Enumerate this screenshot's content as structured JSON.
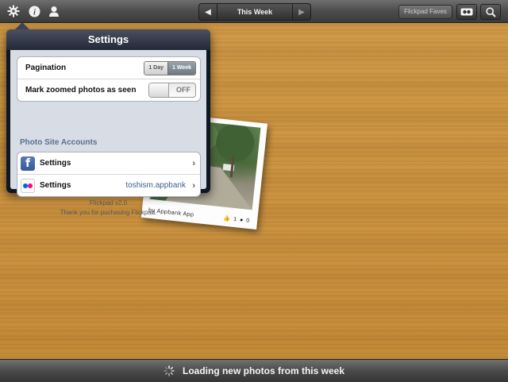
{
  "topbar": {
    "left_icons": [
      "gear-icon",
      "info-icon",
      "person-icon"
    ],
    "week_label": "This Week",
    "prev_icon": "triangle-left-icon",
    "next_icon": "triangle-right-icon",
    "faves_label": "Flickpad Faves",
    "right_icons": [
      "flickr-dots-icon",
      "search-icon"
    ]
  },
  "settings": {
    "title": "Settings",
    "pagination": {
      "label": "Pagination",
      "options": [
        "1 Day",
        "1 Week"
      ],
      "selected": "1 Week"
    },
    "mark_zoomed": {
      "label": "Mark zoomed photos as seen",
      "state": "OFF"
    },
    "accounts_title": "Photo Site Accounts",
    "accounts": [
      {
        "service_icon": "facebook-icon",
        "label": "Settings",
        "value": ""
      },
      {
        "service_icon": "flickr-icon",
        "label": "Settings",
        "value": "toshism.appbank"
      }
    ],
    "version": "Flickpad v2.0",
    "thanks": "Thank you for puchasing Flickpad."
  },
  "photo": {
    "caption": "by Appbank App",
    "likes": "1",
    "comments": "0"
  },
  "status": {
    "icon": "spinner-icon",
    "text": "Loading new photos from this week"
  },
  "colors": {
    "wood": "#cf9540",
    "bar": "#4a4a4a",
    "accent_link": "#3d5f8f"
  }
}
